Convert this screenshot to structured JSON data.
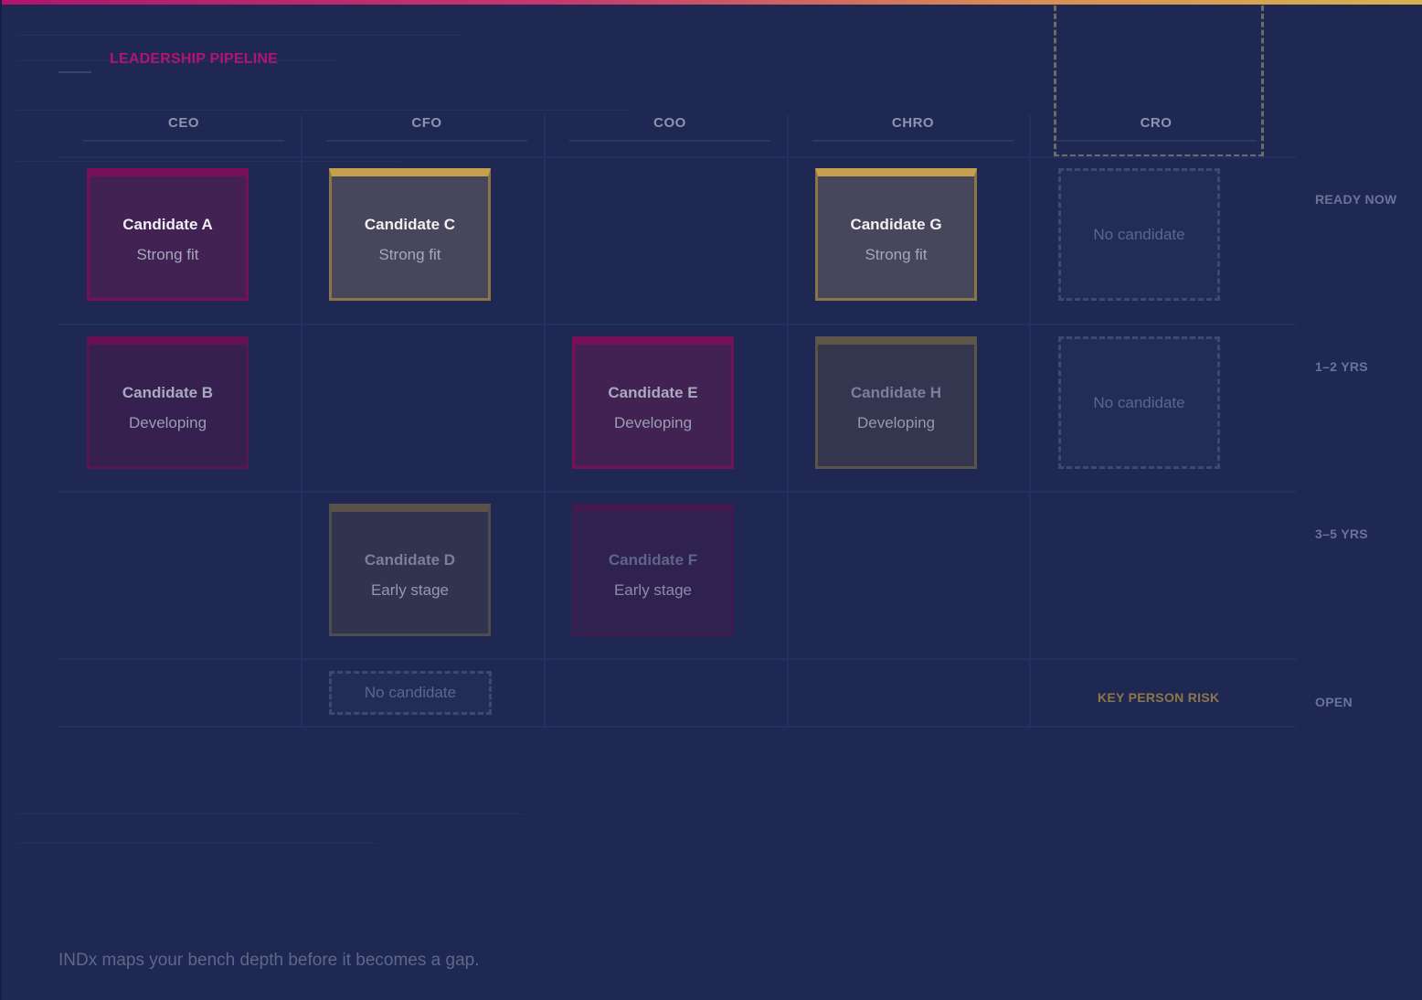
{
  "header": {
    "title": "LEADERSHIP PIPELINE"
  },
  "columns": [
    "CEO",
    "CFO",
    "COO",
    "CHRO",
    "CRO"
  ],
  "rows": [
    "READY NOW",
    "1–2 YRS",
    "3–5 YRS",
    "OPEN"
  ],
  "candidates": [
    {
      "name": "Candidate A",
      "status": "Strong fit"
    },
    {
      "name": "Candidate C",
      "status": "Strong fit"
    },
    {
      "name": "Candidate G",
      "status": "Strong fit"
    },
    {
      "name": "Candidate B",
      "status": "Developing"
    },
    {
      "name": "Candidate E",
      "status": "Developing"
    },
    {
      "name": "Candidate H",
      "status": "Developing"
    },
    {
      "name": "Candidate D",
      "status": "Early stage"
    },
    {
      "name": "Candidate F",
      "status": "Early stage"
    }
  ],
  "empty_label": "No candidate",
  "risk_label": "KEY PERSON RISK",
  "footer": {
    "text": "INDx maps your bench depth before it becomes a gap."
  },
  "colors": {
    "accent_magenta": "#b3146f",
    "accent_gold": "#c5a14b",
    "background": "#1e2852"
  }
}
